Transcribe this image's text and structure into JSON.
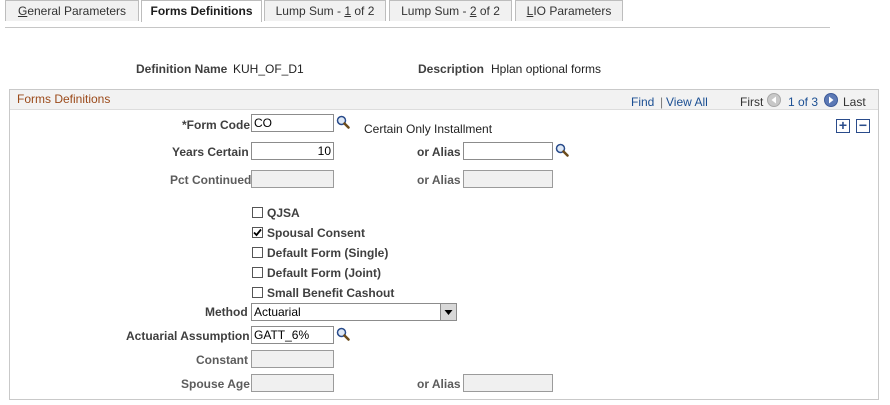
{
  "tabs": [
    {
      "pre": "",
      "u": "G",
      "post": "eneral Parameters",
      "active": false
    },
    {
      "pre": "",
      "u": "",
      "post": "Forms Definitions",
      "active": true
    },
    {
      "pre": "Lump Sum - ",
      "u": "1",
      "post": " of 2",
      "active": false
    },
    {
      "pre": "Lump Sum - ",
      "u": "2",
      "post": " of 2",
      "active": false
    },
    {
      "pre": "",
      "u": "L",
      "post": "IO Parameters",
      "active": false
    }
  ],
  "header": {
    "definition_name_label": "Definition Name",
    "definition_name_value": "KUH_OF_D1",
    "description_label": "Description",
    "description_value": "Hplan optional forms"
  },
  "section": {
    "title": "Forms Definitions",
    "find": "Find",
    "separator": "|",
    "view_all": "View All",
    "first": "First",
    "counter": "1 of 3",
    "last": "Last",
    "add": "+",
    "remove": "−"
  },
  "form": {
    "form_code_label": "*Form Code",
    "form_code_value": "CO",
    "form_code_desc": "Certain Only Installment",
    "years_certain_label": "Years Certain",
    "years_certain_value": "10",
    "or_alias_label": "or Alias",
    "years_alias_value": "",
    "pct_continued_label": "Pct Continued",
    "pct_continued_value": "",
    "pct_alias_value": "",
    "checkboxes": [
      {
        "label": "QJSA",
        "checked": false
      },
      {
        "label": "Spousal Consent",
        "checked": true
      },
      {
        "label": "Default Form (Single)",
        "checked": false
      },
      {
        "label": "Default Form (Joint)",
        "checked": false
      },
      {
        "label": "Small Benefit Cashout",
        "checked": false
      }
    ],
    "method_label": "Method",
    "method_value": "Actuarial",
    "actuarial_label": "Actuarial Assumption",
    "actuarial_value": "GATT_6%",
    "constant_label": "Constant",
    "constant_value": "",
    "spouse_age_label": "Spouse Age",
    "spouse_age_value": "",
    "spouse_alias_value": ""
  },
  "colors": {
    "section_title": "#9b4a1a",
    "link": "#1b4f93"
  }
}
